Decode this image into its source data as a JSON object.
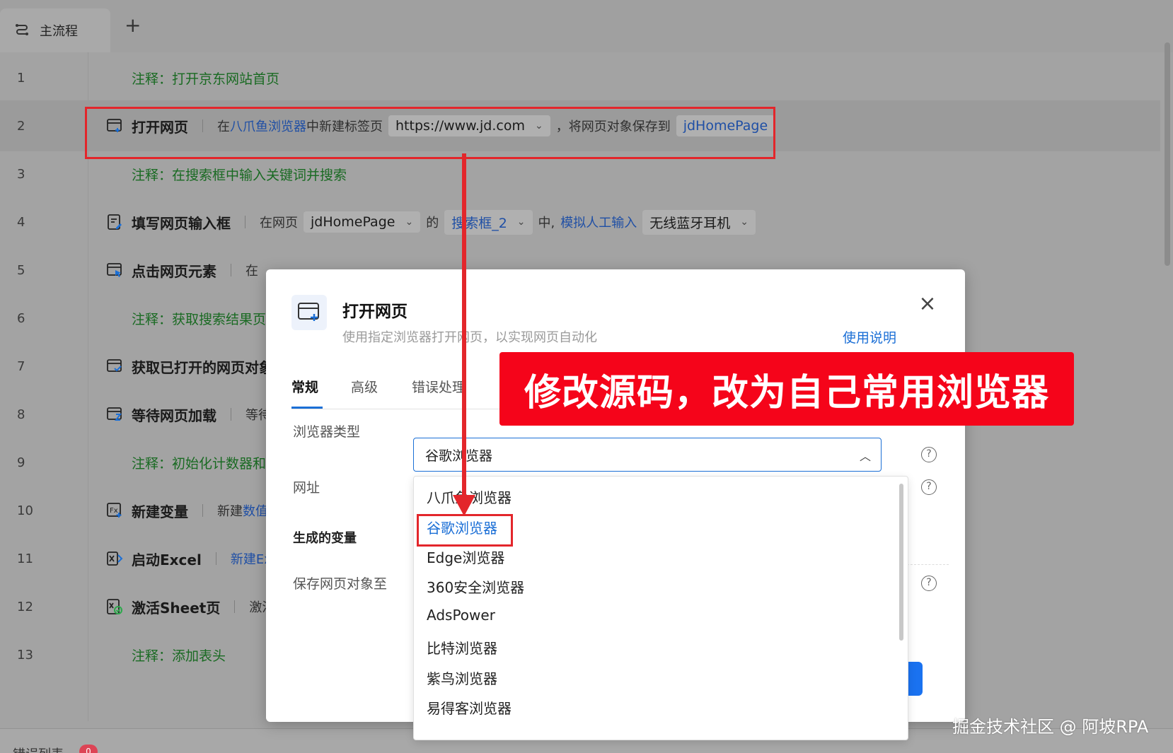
{
  "tabbar": {
    "tab_label": "主流程",
    "add_label": "+"
  },
  "rows": [
    {
      "line": "1",
      "comment": "注释：打开京东网站首页"
    },
    {
      "line": "2",
      "name": "打开网页",
      "t1": "在",
      "link1": "八爪鱼浏览器",
      "t2": "中新建标签页",
      "pill1": "https://www.jd.com",
      "t3": "，将网页对象保存到",
      "var1": "jdHomePage"
    },
    {
      "line": "3",
      "comment": "注释：在搜索框中输入关键词并搜索"
    },
    {
      "line": "4",
      "name": "填写网页输入框",
      "t1": "在网页",
      "pill1": "jdHomePage",
      "t2": "的",
      "pill2": "搜索框_2",
      "t3": "中,",
      "link1": "模拟人工输入",
      "pill3": "无线蓝牙耳机"
    },
    {
      "line": "5",
      "name": "点击网页元素",
      "t1": "在"
    },
    {
      "line": "6",
      "comment": "注释：获取搜索结果页面"
    },
    {
      "line": "7",
      "name": "获取已打开的网页对象"
    },
    {
      "line": "8",
      "name": "等待网页加载",
      "t1": "等待"
    },
    {
      "line": "9",
      "comment": "注释：初始化计数器和E"
    },
    {
      "line": "10",
      "name": "新建变量",
      "t1": "新建",
      "link1": "数值"
    },
    {
      "line": "11",
      "name": "启动Excel",
      "link1": "新建Ex"
    },
    {
      "line": "12",
      "name": "激活Sheet页",
      "t1": "激活"
    },
    {
      "line": "13",
      "comment": "注释：添加表头"
    }
  ],
  "dialog": {
    "title": "打开网页",
    "description": "使用指定浏览器打开网页，以实现网页自动化",
    "help_link": "使用说明",
    "tabs": [
      "常规",
      "高级",
      "错误处理"
    ],
    "browser_label": "浏览器类型",
    "browser_value": "谷歌浏览器",
    "url_label": "网址",
    "gen_var_label": "生成的变量",
    "save_label": "保存网页对象至",
    "help_mark": "?",
    "close_mark": "×"
  },
  "dropdown": {
    "options": [
      "八爪鱼浏览器",
      "谷歌浏览器",
      "Edge浏览器",
      "360安全浏览器",
      "AdsPower",
      "比特浏览器",
      "紫鸟浏览器",
      "易得客浏览器"
    ],
    "selected": "谷歌浏览器"
  },
  "annotation": {
    "banner_text": "修改源码，改为自己常用浏览器"
  },
  "bottombar": {
    "error_list": "错误列表",
    "error_count": "0"
  },
  "watermark": "掘金技术社区 @ 阿坡RPA",
  "colors": {
    "accent": "#1b6fd6",
    "annotation_red": "#f5041a",
    "comment_green": "#196a22"
  }
}
